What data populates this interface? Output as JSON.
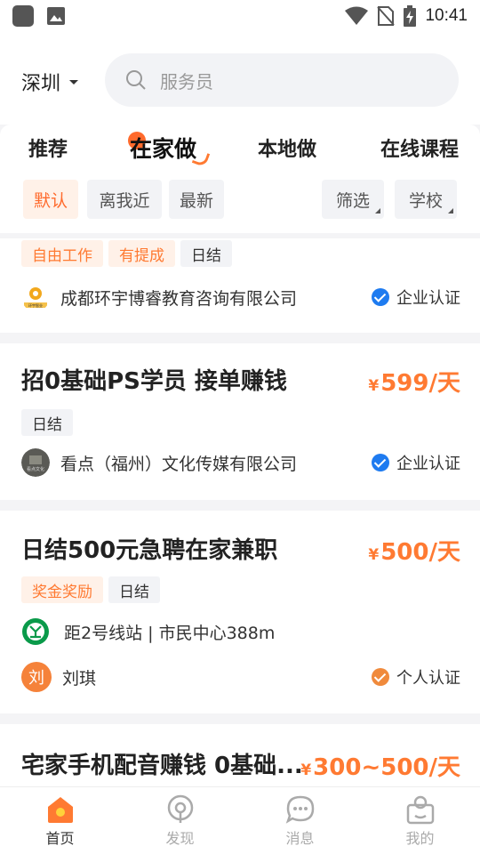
{
  "status_bar": {
    "time": "10:41"
  },
  "header": {
    "city": "深圳",
    "search_placeholder": "服务员"
  },
  "tabs": [
    {
      "label": "推荐"
    },
    {
      "label": "在家做"
    },
    {
      "label": "本地做"
    },
    {
      "label": "在线课程"
    }
  ],
  "filters": {
    "sort": [
      "默认",
      "离我近",
      "最新"
    ],
    "dropdowns": [
      "筛选",
      "学校"
    ]
  },
  "cards": [
    {
      "tags": [
        {
          "text": "自由工作",
          "style": "orange"
        },
        {
          "text": "有提成",
          "style": "orange"
        },
        {
          "text": "日结",
          "style": "gray"
        }
      ],
      "company": "成都环宇博睿教育咨询有限公司",
      "verify": "企业认证",
      "logo_label": "环宇智业"
    },
    {
      "title": "招0基础PS学员  接单赚钱",
      "salary_yen": "¥",
      "salary": "599/天",
      "tags": [
        {
          "text": "日结",
          "style": "gray"
        }
      ],
      "company": "看点（福州）文化传媒有限公司",
      "verify": "企业认证",
      "logo_label": "看点文化"
    },
    {
      "title": "日结500元急聘在家兼职",
      "salary_yen": "¥",
      "salary": "500/天",
      "tags": [
        {
          "text": "奖金奖励",
          "style": "orange"
        },
        {
          "text": "日结",
          "style": "gray"
        }
      ],
      "location": "距2号线站 | 市民中心388m",
      "person": "刘琪",
      "avatar_text": "刘",
      "verify": "个人认证"
    },
    {
      "title": "宅家手机配音赚钱 0基础...",
      "salary_yen": "¥",
      "salary": "300~500/天"
    }
  ],
  "bottom_nav": [
    {
      "label": "首页",
      "icon": "home-icon"
    },
    {
      "label": "发现",
      "icon": "discover-icon"
    },
    {
      "label": "消息",
      "icon": "message-icon"
    },
    {
      "label": "我的",
      "icon": "profile-icon"
    }
  ],
  "colors": {
    "accent": "#ff7a32",
    "verify_blue": "#1e7bf0",
    "verify_orange": "#f08a3c",
    "metro_green": "#0a9a4a"
  }
}
